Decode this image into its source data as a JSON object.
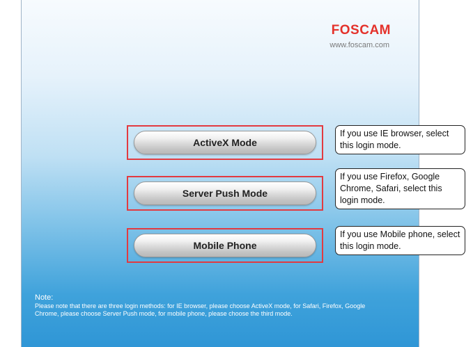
{
  "brand": {
    "logo_text": "FOSCAM",
    "url": "www.foscam.com",
    "accent": "#e4322b"
  },
  "modes": [
    {
      "label": "ActiveX Mode",
      "callout": "If you use IE browser, select this login mode."
    },
    {
      "label": "Server Push Mode",
      "callout": "If you use Firefox, Google Chrome, Safari, select this login mode."
    },
    {
      "label": "Mobile Phone",
      "callout": "If you use Mobile phone, select this login mode."
    }
  ],
  "note": {
    "title": "Note:",
    "text": "Please note that there are three login methods: for IE browser, please choose ActiveX mode, for Safari, Firefox, Google Chrome, please choose Server Push mode, for mobile phone, please choose the third mode."
  }
}
